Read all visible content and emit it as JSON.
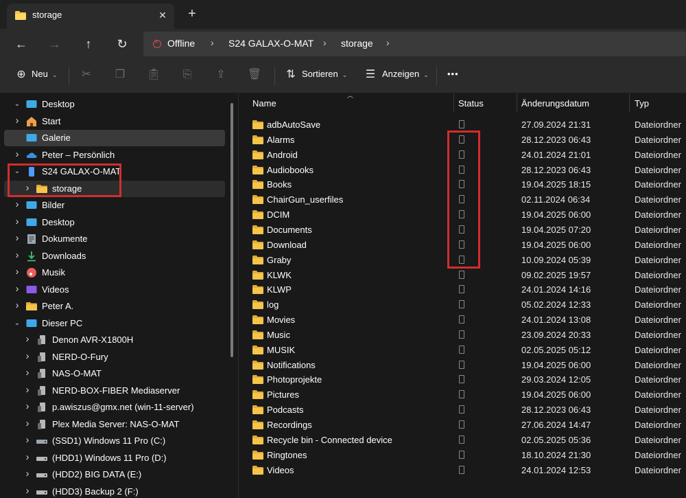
{
  "window": {
    "tab_title": "storage",
    "tab_close": "✕",
    "new_tab": "+"
  },
  "address": {
    "crumbs": [
      "Offline",
      "S24 GALAX-O-MAT",
      "storage"
    ],
    "separator": "›"
  },
  "toolbar": {
    "new_label": "Neu",
    "sort_label": "Sortieren",
    "view_label": "Anzeigen",
    "more_label": "•••"
  },
  "sidebar": {
    "items": [
      {
        "label": "Desktop",
        "icon": "desktop-icon",
        "level": 0,
        "chevron": "down"
      },
      {
        "label": "Start",
        "icon": "home-icon",
        "level": 1,
        "chevron": "right"
      },
      {
        "label": "Galerie",
        "icon": "gallery-icon",
        "level": 1,
        "chevron": "none"
      },
      {
        "label": "Peter – Persönlich",
        "icon": "onedrive-icon",
        "level": 1,
        "chevron": "right"
      },
      {
        "label": "S24 GALAX-O-MAT",
        "icon": "phone-icon",
        "level": 1,
        "chevron": "down"
      },
      {
        "label": "storage",
        "icon": "folder-icon",
        "level": 2,
        "chevron": "right"
      },
      {
        "label": "Bilder",
        "icon": "pictures-icon",
        "level": 1,
        "chevron": "right"
      },
      {
        "label": "Desktop",
        "icon": "desktop-icon",
        "level": 1,
        "chevron": "right"
      },
      {
        "label": "Dokumente",
        "icon": "documents-icon",
        "level": 1,
        "chevron": "right"
      },
      {
        "label": "Downloads",
        "icon": "downloads-icon",
        "level": 1,
        "chevron": "right"
      },
      {
        "label": "Musik",
        "icon": "music-icon",
        "level": 1,
        "chevron": "right"
      },
      {
        "label": "Videos",
        "icon": "videos-icon",
        "level": 1,
        "chevron": "right"
      },
      {
        "label": "Peter A.",
        "icon": "folder-icon",
        "level": 1,
        "chevron": "right"
      },
      {
        "label": "Dieser PC",
        "icon": "pc-icon",
        "level": 1,
        "chevron": "down"
      },
      {
        "label": "Denon AVR-X1800H",
        "icon": "media-device-icon",
        "level": 2,
        "chevron": "right"
      },
      {
        "label": "NERD-O-Fury",
        "icon": "media-device-icon",
        "level": 2,
        "chevron": "right"
      },
      {
        "label": "NAS-O-MAT",
        "icon": "media-device-icon",
        "level": 2,
        "chevron": "right"
      },
      {
        "label": "NERD-BOX-FIBER Mediaserver",
        "icon": "media-device-icon",
        "level": 2,
        "chevron": "right"
      },
      {
        "label": "p.awiszus@gmx.net (win-11-server)",
        "icon": "media-device-icon",
        "level": 2,
        "chevron": "right"
      },
      {
        "label": "Plex Media Server: NAS-O-MAT",
        "icon": "media-device-icon",
        "level": 2,
        "chevron": "right"
      },
      {
        "label": "(SSD1) Windows 11 Pro (C:)",
        "icon": "windows-drive-icon",
        "level": 2,
        "chevron": "right"
      },
      {
        "label": "(HDD1) Windows 11 Pro (D:)",
        "icon": "drive-icon",
        "level": 2,
        "chevron": "right"
      },
      {
        "label": "(HDD2) BIG DATA (E:)",
        "icon": "drive-icon",
        "level": 2,
        "chevron": "right"
      },
      {
        "label": "(HDD3) Backup 2 (F:)",
        "icon": "drive-icon",
        "level": 2,
        "chevron": "right"
      }
    ]
  },
  "columns": {
    "name": "Name",
    "status": "Status",
    "date": "Änderungsdatum",
    "type": "Typ"
  },
  "files": [
    {
      "name": "adbAutoSave",
      "date": "27.09.2024 21:31",
      "type": "Dateiordner"
    },
    {
      "name": "Alarms",
      "date": "28.12.2023 06:43",
      "type": "Dateiordner"
    },
    {
      "name": "Android",
      "date": "24.01.2024 21:01",
      "type": "Dateiordner"
    },
    {
      "name": "Audiobooks",
      "date": "28.12.2023 06:43",
      "type": "Dateiordner"
    },
    {
      "name": "Books",
      "date": "19.04.2025 18:15",
      "type": "Dateiordner"
    },
    {
      "name": "ChairGun_userfiles",
      "date": "02.11.2024 06:34",
      "type": "Dateiordner"
    },
    {
      "name": "DCIM",
      "date": "19.04.2025 06:00",
      "type": "Dateiordner"
    },
    {
      "name": "Documents",
      "date": "19.04.2025 07:20",
      "type": "Dateiordner"
    },
    {
      "name": "Download",
      "date": "19.04.2025 06:00",
      "type": "Dateiordner"
    },
    {
      "name": "Graby",
      "date": "10.09.2024 05:39",
      "type": "Dateiordner"
    },
    {
      "name": "KLWK",
      "date": "09.02.2025 19:57",
      "type": "Dateiordner"
    },
    {
      "name": "KLWP",
      "date": "24.01.2024 14:16",
      "type": "Dateiordner"
    },
    {
      "name": "log",
      "date": "05.02.2024 12:33",
      "type": "Dateiordner"
    },
    {
      "name": "Movies",
      "date": "24.01.2024 13:08",
      "type": "Dateiordner"
    },
    {
      "name": "Music",
      "date": "23.09.2024 20:33",
      "type": "Dateiordner"
    },
    {
      "name": "MUSIK",
      "date": "02.05.2025 05:12",
      "type": "Dateiordner"
    },
    {
      "name": "Notifications",
      "date": "19.04.2025 06:00",
      "type": "Dateiordner"
    },
    {
      "name": "Photoprojekte",
      "date": "29.03.2024 12:05",
      "type": "Dateiordner"
    },
    {
      "name": "Pictures",
      "date": "19.04.2025 06:00",
      "type": "Dateiordner"
    },
    {
      "name": "Podcasts",
      "date": "28.12.2023 06:43",
      "type": "Dateiordner"
    },
    {
      "name": "Recordings",
      "date": "27.06.2024 14:47",
      "type": "Dateiordner"
    },
    {
      "name": "Recycle bin - Connected device",
      "date": "02.05.2025 05:36",
      "type": "Dateiordner"
    },
    {
      "name": "Ringtones",
      "date": "18.10.2024 21:30",
      "type": "Dateiordner"
    },
    {
      "name": "Videos",
      "date": "24.01.2024 12:53",
      "type": "Dateiordner"
    }
  ],
  "colors": {
    "accent_red": "#d22d2d",
    "folder_yellow": "#f4c54a",
    "selected_bg": "#3a3a3a"
  }
}
